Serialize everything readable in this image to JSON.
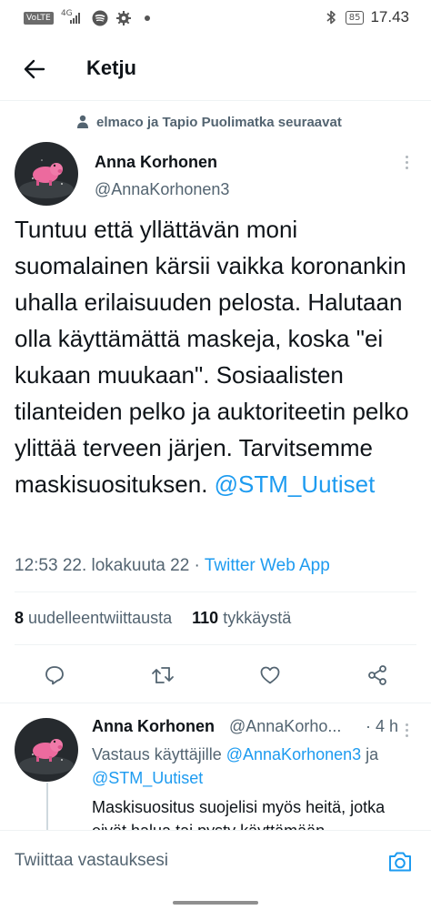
{
  "status_bar": {
    "volte": "VoLTE",
    "network": "4G",
    "battery": "85",
    "time": "17.43",
    "icons": [
      "spotify-icon",
      "gear-icon",
      "dot-icon",
      "bluetooth-icon"
    ]
  },
  "header": {
    "back_icon": "arrow-left-icon",
    "title": "Ketju"
  },
  "social_context": "elmaco ja Tapio Puolimatka seuraavat",
  "tweet": {
    "author_name": "Anna Korhonen",
    "author_handle": "@AnnaKorhonen3",
    "text": "Tuntuu että yllättävän moni suomalainen kärsii vaikka koronankin uhalla erilaisuuden pelosta. Halutaan olla käyttämättä maskeja, koska \"ei kukaan muukaan\". Sosiaalisten tilanteiden pelko ja auktoriteetin pelko ylittää terveen järjen. Tarvitsemme maskisuosituksen.",
    "mention": "@STM_Uutiset",
    "timestamp": "12:53 22. lokakuuta 22",
    "separator": "·",
    "source": "Twitter Web App",
    "retweets_count": "8",
    "retweets_label": "uudelleentwiittausta",
    "likes_count": "110",
    "likes_label": "tykkäystä"
  },
  "reply": {
    "author_name": "Anna Korhonen",
    "author_handle": "@AnnaKorho...",
    "separator": "·",
    "time": "4 h",
    "replying_prefix": "Vastaus käyttäjille",
    "replying_to_1": "@AnnaKorhonen3",
    "replying_join": "ja",
    "replying_to_2": "@STM_Uutiset",
    "text": "Maskisuositus suojelisi myös heitä, jotka eivät halua tai pysty käyttämään"
  },
  "composer": {
    "placeholder": "Twiittaa vastauksesi"
  },
  "colors": {
    "accent": "#1d9bf0",
    "text": "#0f1419",
    "secondary": "#536471"
  }
}
